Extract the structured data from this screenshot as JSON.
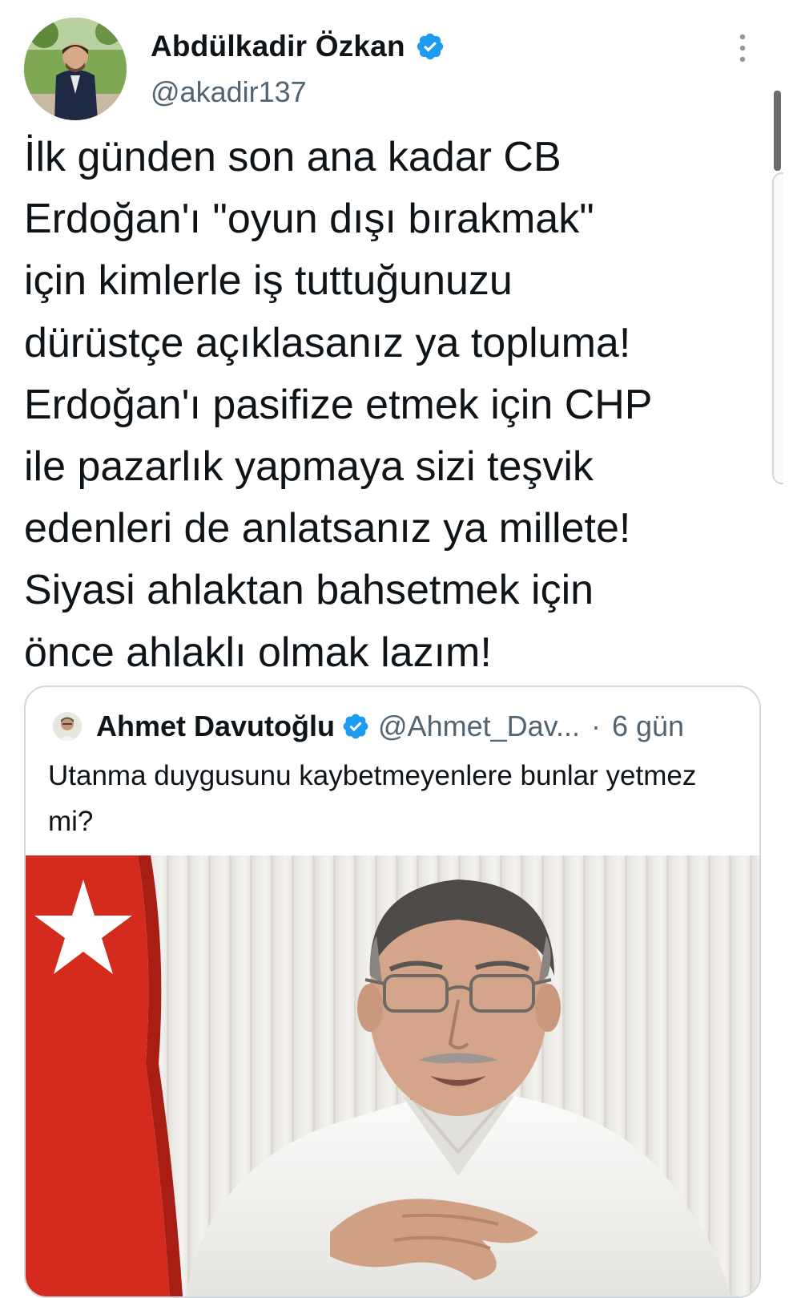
{
  "author": {
    "display_name": "Abdülkadir Özkan",
    "handle": "@akadir137",
    "verified": true
  },
  "tweet": {
    "text": "İlk günden son ana kadar CB\nErdoğan'ı \"oyun dışı bırakmak\"\niçin kimlerle iş tuttuğunuzu\ndürüstçe açıklasanız ya topluma!\nErdoğan'ı pasifize etmek için CHP\nile pazarlık yapmaya sizi teşvik\nedenleri de anlatsanız ya millete!\nSiyasi ahlaktan bahsetmek için\nönce ahlaklı olmak lazım!"
  },
  "quoted_tweet": {
    "display_name": "Ahmet Davutoğlu",
    "handle": "@Ahmet_Dav...",
    "separator": "·",
    "time": "6 gün",
    "verified": true,
    "text": "Utanma duygusunu kaybetmeyenlere bunlar yetmez mi?"
  },
  "colors": {
    "text_primary": "#0f1419",
    "text_secondary": "#536471",
    "verified_blue": "#1d9bf0",
    "card_border": "#cfd9de",
    "flag_red": "#d52b1e"
  },
  "icons": {
    "verified": "verified-badge-icon",
    "more": "more-vertical-icon"
  }
}
